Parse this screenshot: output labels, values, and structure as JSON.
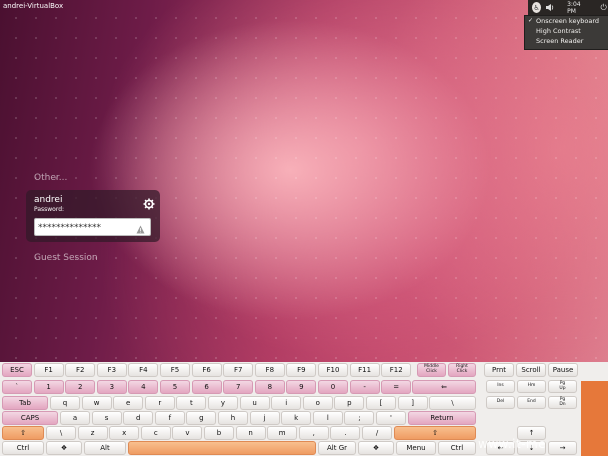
{
  "panel": {
    "hostname": "andrei-VirtualBox",
    "time": "3:04 PM",
    "accessibility_menu": [
      {
        "label": "Onscreen keyboard",
        "checked": true
      },
      {
        "label": "High Contrast",
        "checked": false
      },
      {
        "label": "Screen Reader",
        "checked": false
      }
    ]
  },
  "greeter": {
    "other_label": "Other...",
    "user_name": "andrei",
    "password_label": "Password:",
    "password_value": "**************",
    "guest_label": "Guest Session"
  },
  "keyboard": {
    "fn_row": [
      "ESC",
      "F1",
      "F2",
      "F3",
      "F4",
      "F5",
      "F6",
      "F7",
      "F8",
      "F9",
      "F10",
      "F11",
      "F12"
    ],
    "middle_click": [
      "Middle",
      "Click"
    ],
    "right_click": [
      "Right",
      "Click"
    ],
    "nav_top": [
      "Prnt",
      "Scroll",
      "Pause"
    ],
    "number_row": [
      "`",
      "1",
      "2",
      "3",
      "4",
      "5",
      "6",
      "7",
      "8",
      "9",
      "0",
      "-",
      "=",
      "⇐"
    ],
    "tab_row": [
      "Tab",
      "q",
      "w",
      "e",
      "r",
      "t",
      "y",
      "u",
      "i",
      "o",
      "p",
      "[",
      "]",
      "\\"
    ],
    "caps_row": [
      "CAPS",
      "a",
      "s",
      "d",
      "f",
      "g",
      "h",
      "j",
      "k",
      "l",
      ";",
      "'",
      "Return"
    ],
    "shift_row": [
      "⇧",
      "\\",
      "z",
      "x",
      "c",
      "v",
      "b",
      "n",
      "m",
      ",",
      ".",
      "/",
      "⇧"
    ],
    "bottom_row": [
      "Ctrl",
      "❖",
      "Alt",
      "",
      "Alt Gr",
      "❖",
      "Menu",
      "Ctrl"
    ],
    "ins_block": [
      "Ins",
      "Hm",
      "Pg Up",
      "Del",
      "End",
      "Pg Dn"
    ],
    "arrows": [
      "↑",
      "←",
      "↓",
      "→"
    ]
  },
  "watermark": "www.it-me",
  "colors": {
    "accent_pink": "#e3a6c0",
    "accent_orange": "#ef9c63",
    "panel_dark": "#2a2624"
  }
}
